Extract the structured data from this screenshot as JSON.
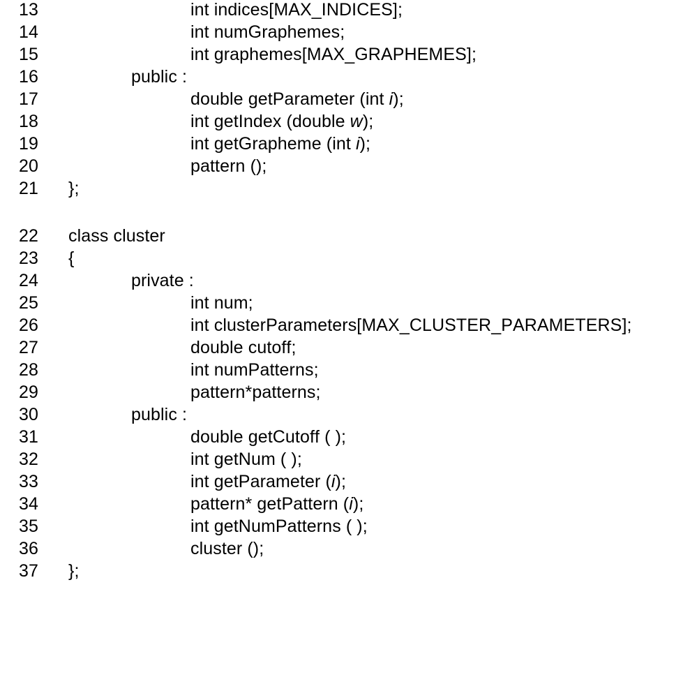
{
  "lines": [
    {
      "num": "13",
      "indent": 3,
      "segments": [
        {
          "text": "int indices[MAX_INDICES];"
        }
      ]
    },
    {
      "num": "14",
      "indent": 3,
      "segments": [
        {
          "text": "int numGraphemes;"
        }
      ]
    },
    {
      "num": "15",
      "indent": 3,
      "segments": [
        {
          "text": "int graphemes[MAX_GRAPHEMES];"
        }
      ]
    },
    {
      "num": "16",
      "indent": 2,
      "segments": [
        {
          "text": "public :"
        }
      ]
    },
    {
      "num": "17",
      "indent": 3,
      "segments": [
        {
          "text": "double getParameter (int "
        },
        {
          "text": "i",
          "italic": true
        },
        {
          "text": ");"
        }
      ]
    },
    {
      "num": "18",
      "indent": 3,
      "segments": [
        {
          "text": "int getIndex (double "
        },
        {
          "text": "w",
          "italic": true
        },
        {
          "text": ");"
        }
      ]
    },
    {
      "num": "19",
      "indent": 3,
      "segments": [
        {
          "text": "int getGrapheme (int "
        },
        {
          "text": "i",
          "italic": true
        },
        {
          "text": ");"
        }
      ]
    },
    {
      "num": "20",
      "indent": 3,
      "segments": [
        {
          "text": "pattern ();"
        }
      ]
    },
    {
      "num": "21",
      "indent": 1,
      "segments": [
        {
          "text": "};"
        }
      ]
    },
    {
      "blank": true
    },
    {
      "num": "22",
      "indent": 1,
      "segments": [
        {
          "text": "class cluster"
        }
      ]
    },
    {
      "num": "23",
      "indent": 1,
      "segments": [
        {
          "text": "{"
        }
      ]
    },
    {
      "num": "24",
      "indent": 2,
      "segments": [
        {
          "text": "private :"
        }
      ]
    },
    {
      "num": "25",
      "indent": 3,
      "segments": [
        {
          "text": "int num;"
        }
      ]
    },
    {
      "num": "26",
      "indent": 3,
      "segments": [
        {
          "text": "int clusterParameters[MAX_CLUSTER_PARAMETERS];"
        }
      ]
    },
    {
      "num": "27",
      "indent": 3,
      "segments": [
        {
          "text": "double cutoff;"
        }
      ]
    },
    {
      "num": "28",
      "indent": 3,
      "segments": [
        {
          "text": "int numPatterns;"
        }
      ]
    },
    {
      "num": "29",
      "indent": 3,
      "segments": [
        {
          "text": "pattern*patterns;"
        }
      ]
    },
    {
      "num": "30",
      "indent": 2,
      "segments": [
        {
          "text": "public :"
        }
      ]
    },
    {
      "num": "31",
      "indent": 3,
      "segments": [
        {
          "text": "double getCutoff ( );"
        }
      ]
    },
    {
      "num": "32",
      "indent": 3,
      "segments": [
        {
          "text": "int getNum ( );"
        }
      ]
    },
    {
      "num": "33",
      "indent": 3,
      "segments": [
        {
          "text": "int getParameter ("
        },
        {
          "text": "i",
          "italic": true
        },
        {
          "text": ");"
        }
      ]
    },
    {
      "num": "34",
      "indent": 3,
      "segments": [
        {
          "text": "pattern* getPattern ("
        },
        {
          "text": "i",
          "italic": true
        },
        {
          "text": ");"
        }
      ]
    },
    {
      "num": "35",
      "indent": 3,
      "segments": [
        {
          "text": "int getNumPatterns ( );"
        }
      ]
    },
    {
      "num": "36",
      "indent": 3,
      "segments": [
        {
          "text": "cluster ();"
        }
      ]
    },
    {
      "num": "37",
      "indent": 1,
      "segments": [
        {
          "text": "};"
        }
      ]
    }
  ]
}
